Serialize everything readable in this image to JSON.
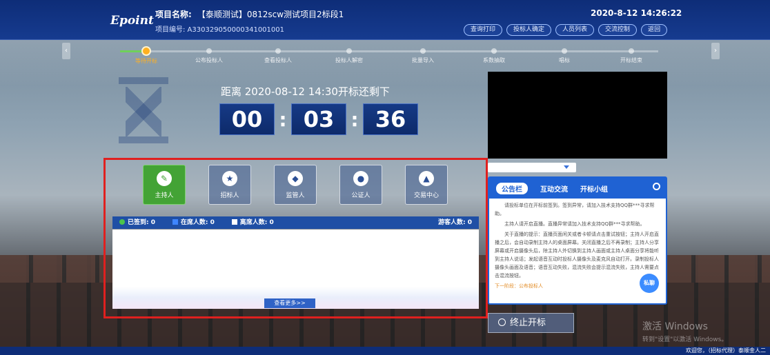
{
  "header": {
    "logo": "Epoint",
    "project_name_label": "项目名称:",
    "project_name": "【泰顺测试】0812scw测试项目2标段1",
    "project_code": "项目编号: A330329050000341001001",
    "datetime": "2020-8-12  14:26:22",
    "buttons": [
      "查询打印",
      "投标人确定",
      "人员列表",
      "交流控制",
      "返回"
    ]
  },
  "steps": [
    {
      "label": "等待开标",
      "active": true
    },
    {
      "label": "公布投标人",
      "active": false
    },
    {
      "label": "查看投标人",
      "active": false
    },
    {
      "label": "投标人解密",
      "active": false
    },
    {
      "label": "批量导入",
      "active": false
    },
    {
      "label": "系数抽取",
      "active": false
    },
    {
      "label": "唱标",
      "active": false
    },
    {
      "label": "开标结束",
      "active": false
    }
  ],
  "countdown": {
    "label": "距离 2020-08-12 14:30开标还剩下",
    "hours": "00",
    "minutes": "03",
    "seconds": "36"
  },
  "roles": [
    {
      "label": "主持人",
      "icon": "host-icon",
      "glyph": "✎",
      "active": true
    },
    {
      "label": "招标人",
      "icon": "tenderer-icon",
      "glyph": "★",
      "active": false
    },
    {
      "label": "监管人",
      "icon": "shield-icon",
      "glyph": "◆",
      "active": false
    },
    {
      "label": "公证人",
      "icon": "notary-icon",
      "glyph": "●",
      "active": false
    },
    {
      "label": "交易中心",
      "icon": "center-icon",
      "glyph": "▲",
      "active": false
    }
  ],
  "stats": {
    "signed": "已签到: 0",
    "online": "在席人数: 0",
    "offline": "离席人数: 0",
    "guests": "游客人数: 0"
  },
  "more_button": "查看更多>>",
  "notice": {
    "tabs": [
      "公告栏",
      "互动交流",
      "开标小组"
    ],
    "paragraphs": [
      "请投标单位在开标前签到。签到异常，请加入技术支持QQ群***寻求帮助。",
      "主持人请开启直播。直播异常请加入技术支持QQ群***寻求帮助。",
      "关于直播的提示：直播页面闲关或者卡顿请点击重试按钮；主持人开启直播之后，会自动录制主持人的桌面屏幕。关闭直播之后不再录制；主持人分享屏幕或开启摄像头后，除主持人外切换到主持人画面或主持人桌面分享将能听到主持人说话；发起语音互动时投标人摄像头及麦克风自动打开。录制投标人摄像头画面及语音；语音互动失败，混流失败会提示混流失败，主持人需要点击混流按钮。"
    ],
    "next_step": "下一阶段：公布投标人",
    "chat_bubble": "私聊"
  },
  "stop_button": "终止开标",
  "watermark": {
    "line1": "激活 Windows",
    "line2": "转到\"设置\"以激活 Windows。"
  },
  "bottom": {
    "welcome": "欢迎您，（招标代理）泰顺金人二"
  }
}
